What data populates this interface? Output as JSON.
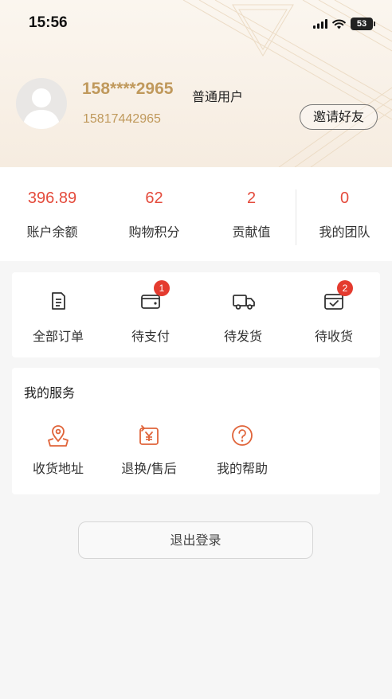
{
  "status_bar": {
    "time": "15:56",
    "battery": "53"
  },
  "profile": {
    "phone_masked": "158****2965",
    "level": "普通用户",
    "phone_full": "15817442965",
    "invite_label": "邀请好友"
  },
  "stats": [
    {
      "value": "396.89",
      "label": "账户余额"
    },
    {
      "value": "62",
      "label": "购物积分"
    },
    {
      "value": "2",
      "label": "贡献值"
    },
    {
      "value": "0",
      "label": "我的团队"
    }
  ],
  "orders": [
    {
      "label": "全部订单",
      "icon": "document-icon",
      "badge": ""
    },
    {
      "label": "待支付",
      "icon": "wallet-icon",
      "badge": "1"
    },
    {
      "label": "待发货",
      "icon": "truck-icon",
      "badge": ""
    },
    {
      "label": "待收货",
      "icon": "box-check-icon",
      "badge": "2"
    }
  ],
  "services": {
    "title": "我的服务",
    "items": [
      {
        "label": "收货地址",
        "icon": "location-icon"
      },
      {
        "label": "退换/售后",
        "icon": "refund-icon"
      },
      {
        "label": "我的帮助",
        "icon": "help-icon"
      }
    ]
  },
  "logout_label": "退出登录",
  "colors": {
    "accent": "#e44b3c",
    "gold": "#c0995c",
    "icon_orange": "#e0643a"
  }
}
